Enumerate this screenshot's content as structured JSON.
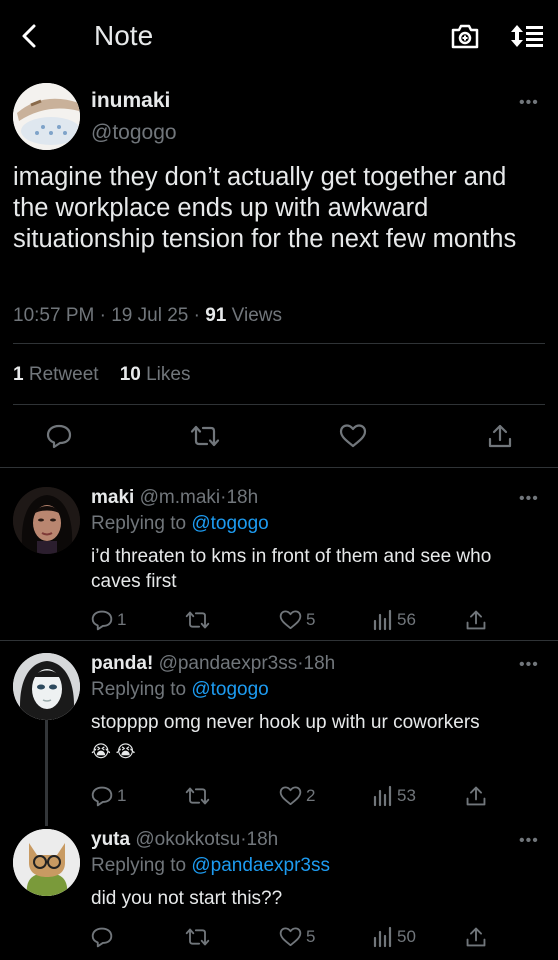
{
  "header": {
    "title": "Note"
  },
  "main_tweet": {
    "name": "inumaki",
    "handle": "@togogo",
    "text": "imagine they don’t actually get together and the workplace ends up with awkward situationship tension for the next few months",
    "time": "10:57 PM",
    "date": "19 Jul 25",
    "views_count": "91",
    "views_label": "Views",
    "retweets_count": "1",
    "retweets_label": "Retweet",
    "likes_count": "10",
    "likes_label": "Likes",
    "sep": "·"
  },
  "replies": [
    {
      "name": "maki",
      "handle": "@m.maki",
      "age": "18h",
      "replying_label": "Replying to",
      "replying_to": "@togogo",
      "text": "i’d threaten to kms in front of them and see who caves first",
      "reply_count": "1",
      "retweet_count": "",
      "like_count": "5",
      "view_count": "56"
    },
    {
      "name": "panda!",
      "handle": "@pandaexpr3ss",
      "age": "18h",
      "replying_label": "Replying to",
      "replying_to": "@togogo",
      "text": "stopppp omg never hook up with ur coworkers",
      "emoji": "😭 😭",
      "reply_count": "1",
      "retweet_count": "",
      "like_count": "2",
      "view_count": "53"
    },
    {
      "name": "yuta",
      "handle": "@okokkotsu",
      "age": "18h",
      "replying_label": "Replying to",
      "replying_to": "@pandaexpr3ss",
      "text": "did you not start this??",
      "reply_count": "",
      "retweet_count": "",
      "like_count": "5",
      "view_count": "50"
    }
  ],
  "colors": {
    "background": "#000000",
    "link": "#1d9bf0",
    "muted": "#71767b",
    "divider": "#2f3336"
  }
}
